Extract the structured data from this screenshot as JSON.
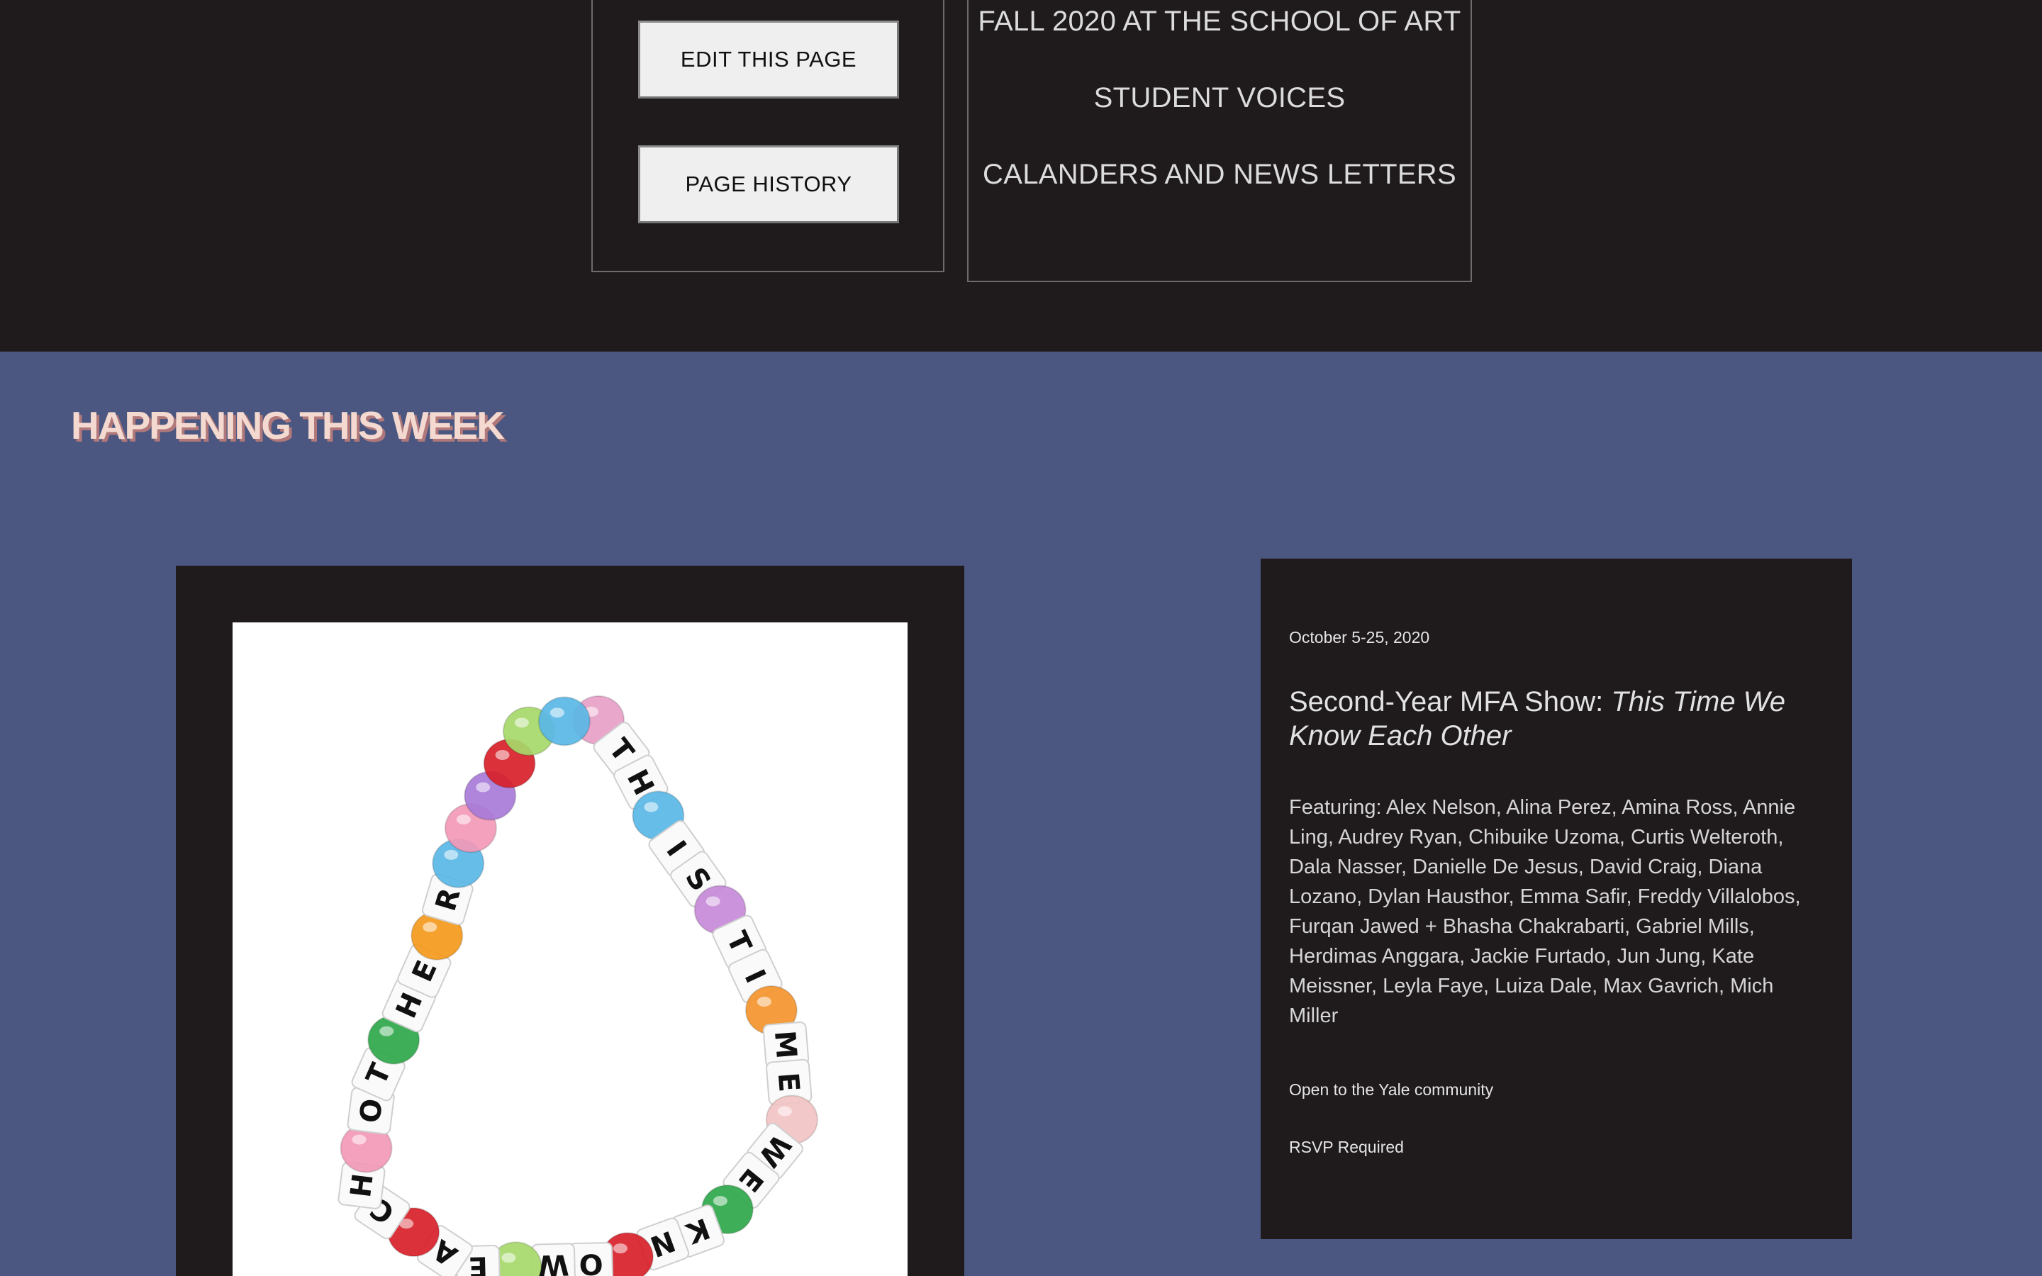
{
  "header": {
    "buttons": {
      "edit": "EDIT THIS PAGE",
      "history": "PAGE HISTORY"
    },
    "nav": [
      "FALL 2020 AT THE SCHOOL OF ART",
      "STUDENT VOICES",
      "CALANDERS AND NEWS LETTERS"
    ]
  },
  "section": {
    "title": "HAPPENING THIS WEEK"
  },
  "event": {
    "date": "October 5-25, 2020",
    "title_prefix": "Second-Year MFA Show: ",
    "title_italic": "This Time We Know Each Other",
    "featuring": "Featuring: Alex Nelson, Alina Perez, Amina Ross, Annie Ling, Audrey Ryan, Chibuike Uzoma, Curtis Welteroth, Dala Nasser, Danielle De Jesus, David Craig, Diana Lozano, Dylan Hausthor, Emma Safir, Freddy Villalobos, Furqan Jawed + Bhasha Chakrabarti, Gabriel Mills, Herdimas Anggara, Jackie Furtado, Jun Jung, Kate Meissner, Leyla Faye, Luiza Dale, Max Gavrich, Mich Miller",
    "open_to": "Open to the Yale community",
    "rsvp": "RSVP Required"
  },
  "bracelet": {
    "letters": [
      "T",
      "H",
      "I",
      "S",
      "T",
      "I",
      "M",
      "E",
      "W",
      "E",
      "K",
      "N",
      "O",
      "W",
      "E",
      "A",
      "C",
      "H",
      "O",
      "T",
      "H",
      "E",
      "R"
    ],
    "bead_colors": [
      "#e8a0c8",
      "#5ab8e6",
      "#c78ad8",
      "#f5952e",
      "#f2c4c4",
      "#2fa84b",
      "#d8202a",
      "#a7d96a",
      "#d8202a",
      "#f29ab8",
      "#2fa84b",
      "#f59a1c",
      "#5ab8e6",
      "#f29ab8",
      "#a97ad8",
      "#d8202a",
      "#a7d96a",
      "#5ab8e6"
    ]
  }
}
